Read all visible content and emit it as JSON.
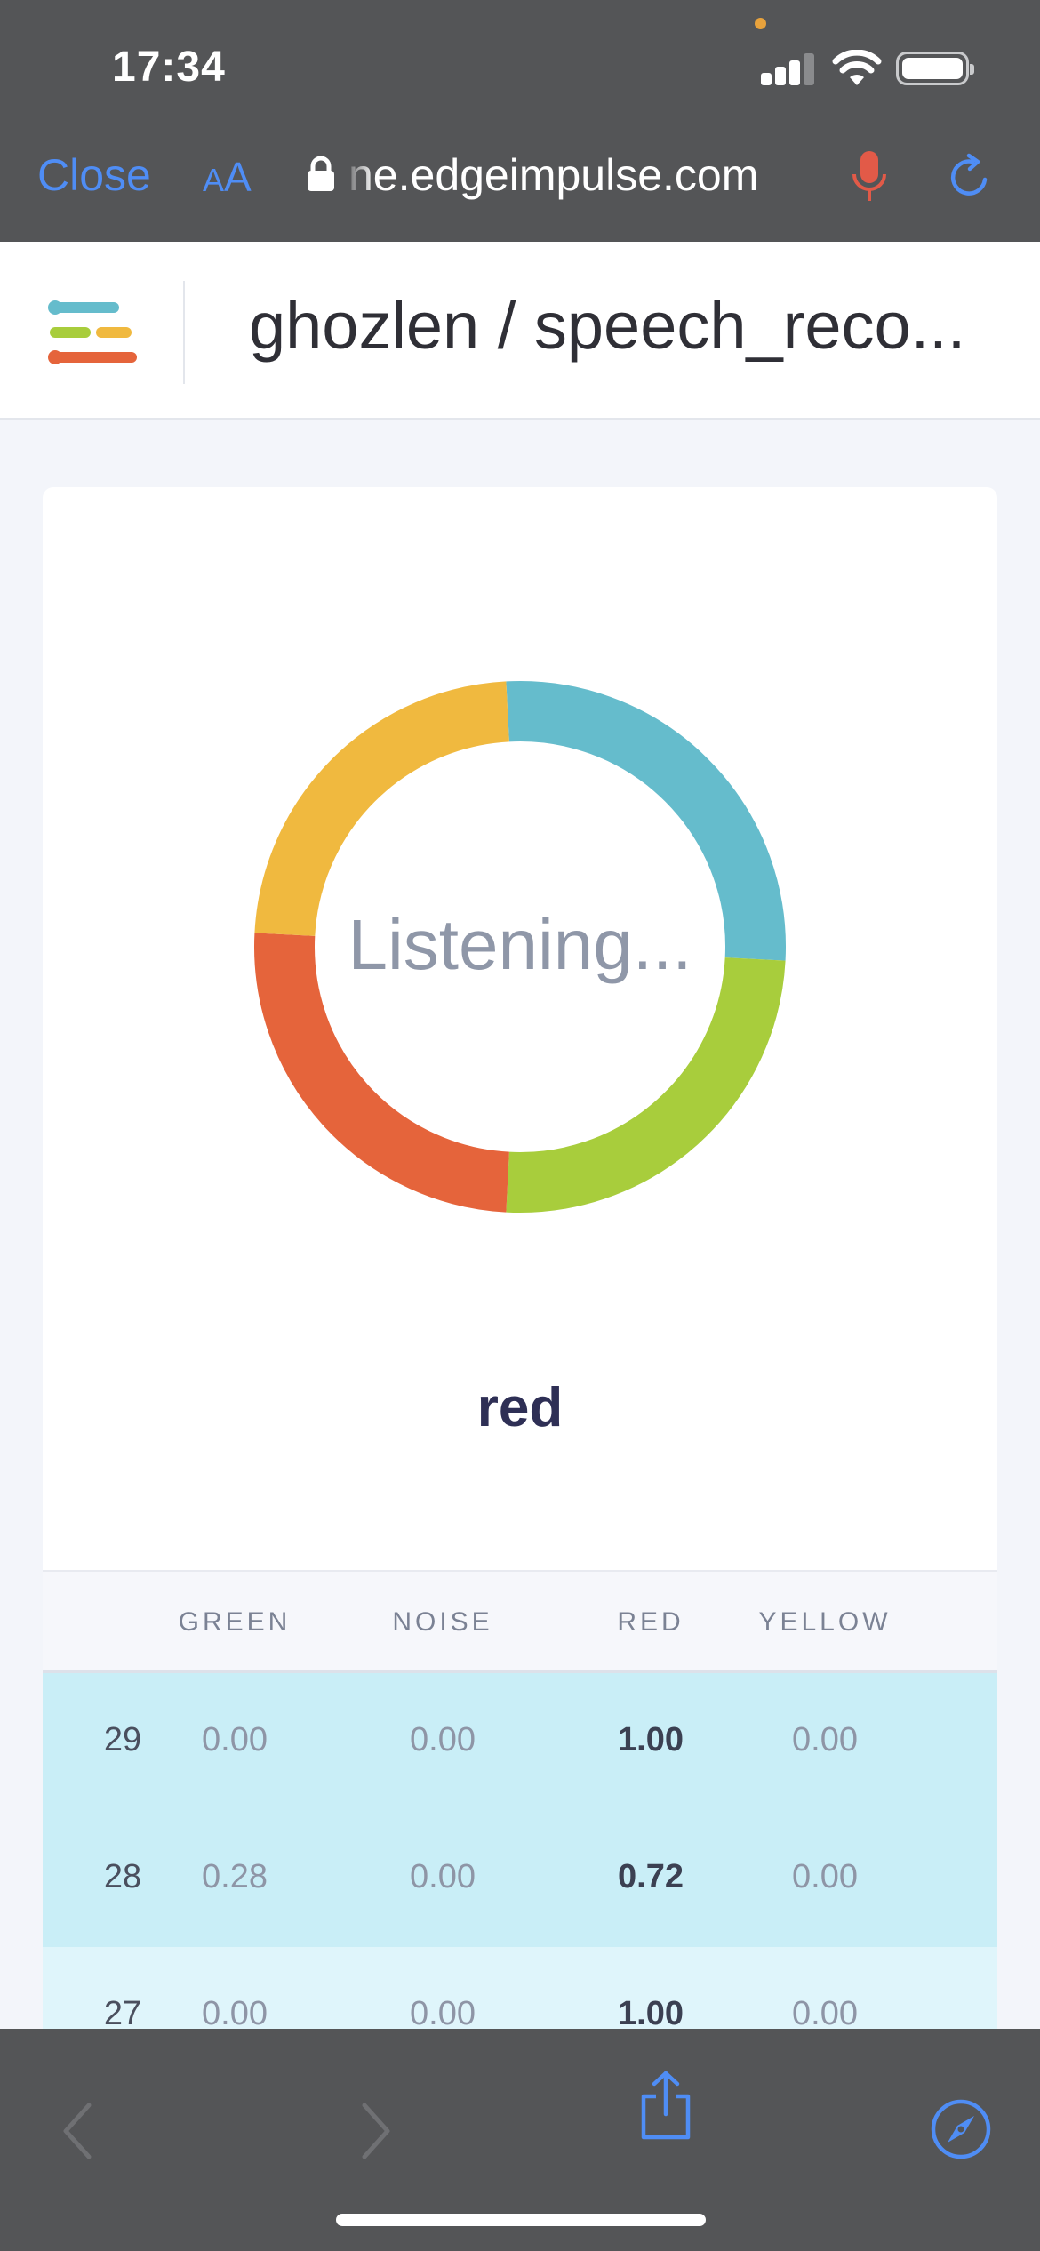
{
  "status_bar": {
    "time": "17:34"
  },
  "browser": {
    "close_label": "Close",
    "aa_label_small": "A",
    "aa_label_large": "A",
    "url": "ne.edgeimpulse.com"
  },
  "header": {
    "title": "ghozlen / speech_reco..."
  },
  "classifier": {
    "center_text": "Listening...",
    "result": "red",
    "segment_colors": [
      "#65bccc",
      "#a8cd3c",
      "#e5643b",
      "#f0b93f"
    ]
  },
  "table": {
    "columns": [
      "GREEN",
      "NOISE",
      "RED",
      "YELLOW"
    ],
    "rows": [
      {
        "index": "29",
        "green": "0.00",
        "noise": "0.00",
        "red": "1.00",
        "yellow": "0.00"
      },
      {
        "index": "28",
        "green": "0.28",
        "noise": "0.00",
        "red": "0.72",
        "yellow": "0.00"
      },
      {
        "index": "27",
        "green": "0.00",
        "noise": "0.00",
        "red": "1.00",
        "yellow": "0.00"
      }
    ]
  },
  "colors": {
    "accent": "#4f8df5",
    "mic": "#e25a48",
    "chrome": "#545557"
  }
}
